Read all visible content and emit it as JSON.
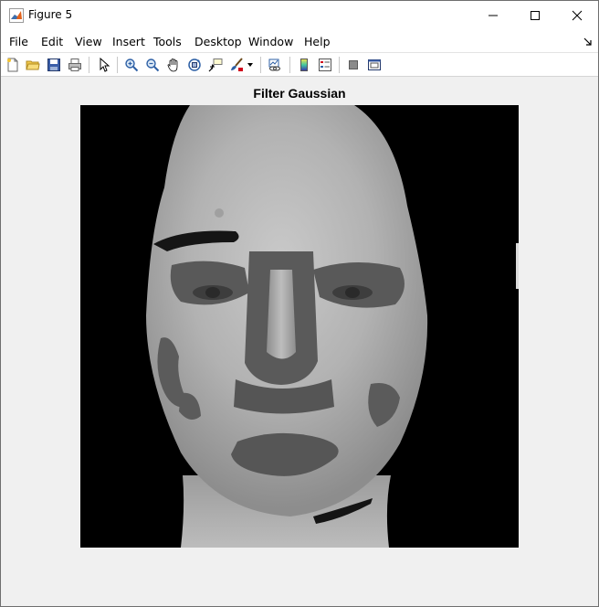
{
  "window": {
    "title": "Figure 5"
  },
  "menu": {
    "items": [
      "File",
      "Edit",
      "View",
      "Insert",
      "Tools",
      "Desktop",
      "Window",
      "Help"
    ]
  },
  "toolbar": {
    "buttons": [
      "new-figure-icon",
      "open-file-icon",
      "save-icon",
      "print-icon",
      "edit-plot-arrow-icon",
      "zoom-in-icon",
      "zoom-out-icon",
      "pan-hand-icon",
      "rotate-3d-icon",
      "data-cursor-icon",
      "brush-icon",
      "link-plot-icon",
      "colorbar-icon",
      "legend-icon",
      "hide-plot-tools-icon",
      "show-plot-tools-icon"
    ]
  },
  "plot": {
    "title": "Filter Gaussian",
    "image_description_colors": {
      "background": "#000000",
      "skin_light": "#bdbdbd",
      "skin_mid": "#9a9a9a",
      "dark_patch": "#5a5a5a"
    }
  }
}
